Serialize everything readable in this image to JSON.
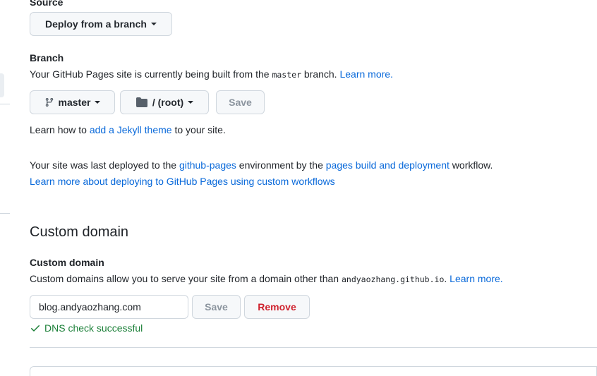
{
  "source": {
    "label": "Source",
    "dropdown_label": "Deploy from a branch"
  },
  "branch": {
    "label": "Branch",
    "desc_before": "Your GitHub Pages site is currently being built from the ",
    "branch_code": "master",
    "desc_after": " branch.",
    "learn_more": "Learn more.",
    "branch_select": "master",
    "folder_select": "/ (root)",
    "save_label": "Save"
  },
  "jekyll": {
    "before": "Learn how to ",
    "link": "add a Jekyll theme",
    "after": " to your site."
  },
  "deploy": {
    "before": "Your site was last deployed to the ",
    "env_link": "github-pages",
    "middle": " environment by the ",
    "workflow_link": "pages build and deployment",
    "after": " workflow.",
    "learn_link": "Learn more about deploying to GitHub Pages using custom workflows"
  },
  "custom_domain": {
    "heading": "Custom domain",
    "label": "Custom domain",
    "desc_before": "Custom domains allow you to serve your site from a domain other than ",
    "default_domain": "andyaozhang.github.io",
    "desc_after": ".",
    "learn_more": "Learn more.",
    "input_value": "blog.andyaozhang.com",
    "save_label": "Save",
    "remove_label": "Remove",
    "dns_status": "DNS check successful"
  },
  "colors": {
    "link": "#0969da",
    "success": "#1a7f37",
    "danger": "#cf222e"
  }
}
